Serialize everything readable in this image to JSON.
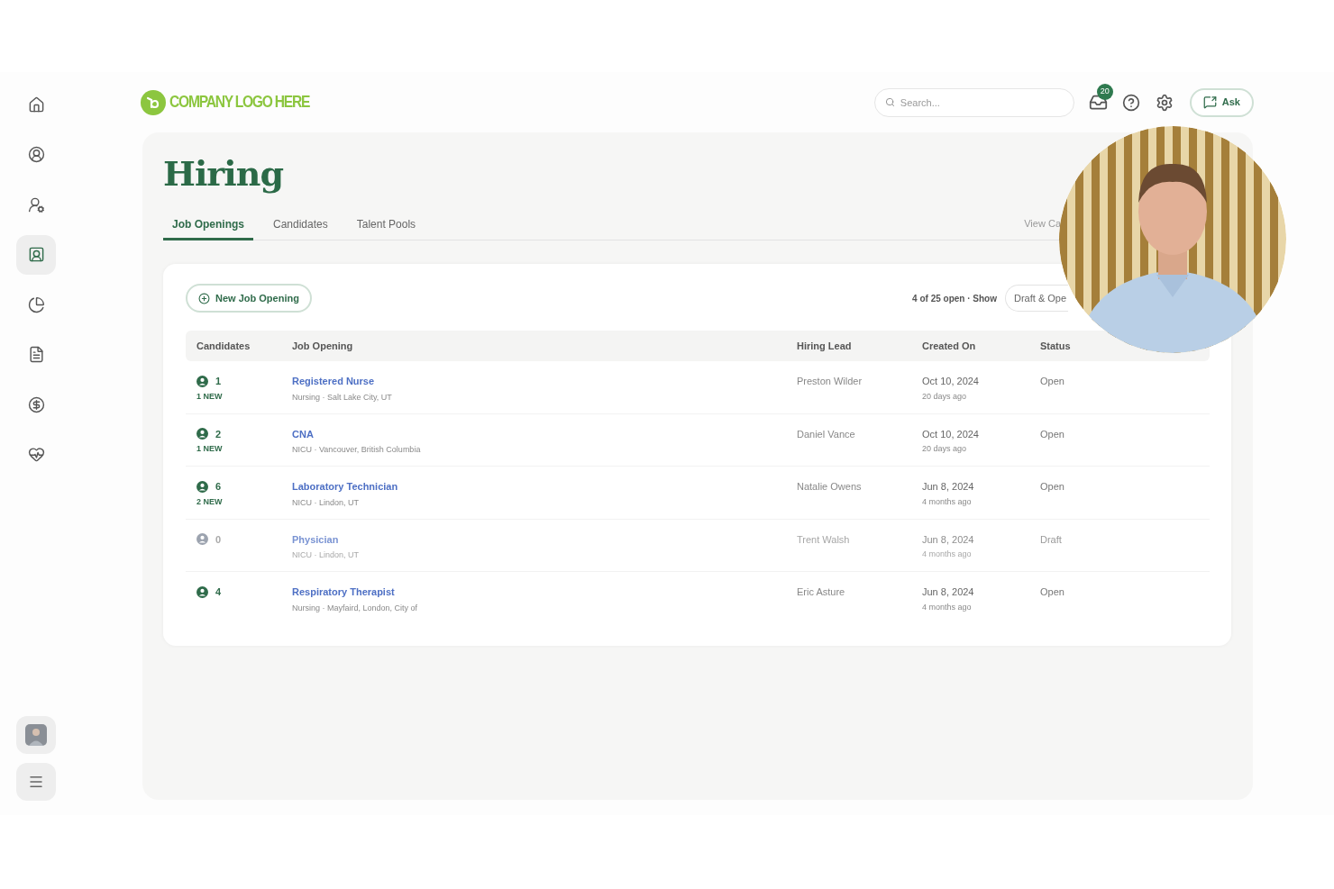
{
  "sidebar": {
    "items": [
      {
        "selected": false
      },
      {
        "selected": false
      },
      {
        "selected": false
      },
      {
        "selected": true
      },
      {
        "selected": false
      },
      {
        "selected": false
      },
      {
        "selected": false
      },
      {
        "selected": false
      }
    ]
  },
  "header": {
    "logo": "COMPANY LOGO HERE",
    "search": {
      "placeholder": "Search..."
    },
    "notification_count": "20",
    "ask_button": "Ask"
  },
  "page": {
    "title": "Hiring",
    "view_link": "View Ca",
    "tabs": [
      {
        "label": "Job Openings",
        "selected": true
      },
      {
        "label": "Candidates",
        "selected": false
      },
      {
        "label": "Talent Pools",
        "selected": false
      }
    ]
  },
  "card": {
    "new_button": "New Job Opening",
    "summary": "4 of 25 open · Show",
    "filter": "Draft & Ope",
    "table": {
      "columns": [
        "Candidates",
        "Job Opening",
        "Hiring Lead",
        "Created On",
        "Status"
      ],
      "rows": [
        {
          "count": "1",
          "new": "1 NEW",
          "title": "Registered Nurse",
          "subtitle": "Nursing · Salt Lake City, UT",
          "lead": "Preston Wilder",
          "date": "Oct 10, 2024",
          "ago": "20 days ago",
          "status": "Open",
          "dimmed": false
        },
        {
          "count": "2",
          "new": "1 NEW",
          "title": "CNA",
          "subtitle": "NICU · Vancouver, British Columbia",
          "lead": "Daniel Vance",
          "date": "Oct 10, 2024",
          "ago": "20 days ago",
          "status": "Open",
          "dimmed": false
        },
        {
          "count": "6",
          "new": "2 NEW",
          "title": "Laboratory Technician",
          "subtitle": "NICU · Lindon, UT",
          "lead": "Natalie Owens",
          "date": "Jun 8, 2024",
          "ago": "4 months ago",
          "status": "Open",
          "dimmed": false
        },
        {
          "count": "0",
          "title": "Physician",
          "subtitle": "NICU · Lindon, UT",
          "lead": "Trent Walsh",
          "date": "Jun 8, 2024",
          "ago": "4 months ago",
          "status": "Draft",
          "dimmed": true
        },
        {
          "count": "4",
          "title": "Respiratory Therapist",
          "subtitle": "Nursing · Mayfaird, London, City of",
          "lead": "Eric Asture",
          "date": "Jun 8, 2024",
          "ago": "4 months ago",
          "status": "Open",
          "dimmed": false
        }
      ]
    }
  }
}
